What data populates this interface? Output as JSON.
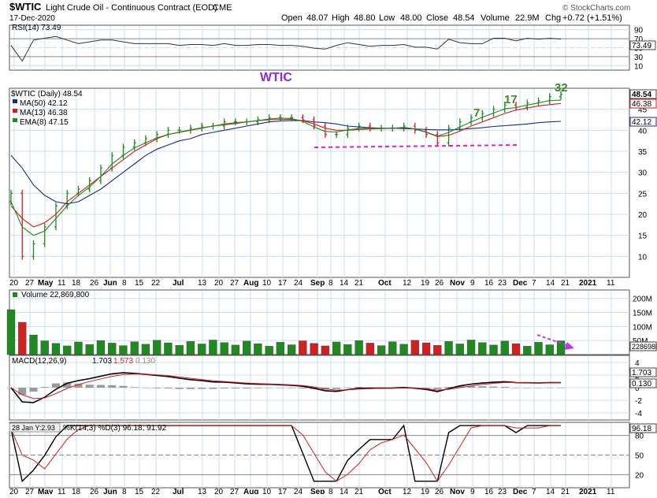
{
  "header": {
    "symbol": "$WTIC",
    "name": "Light Crude Oil - Continuous Contract (EOD)",
    "exchange": "CME",
    "date": "17-Dec-2020",
    "open_label": "Open",
    "open": "48.07",
    "high_label": "High",
    "high": "48.80",
    "low_label": "Low",
    "low": "48.00",
    "close_label": "Close",
    "close": "48.54",
    "volume_label": "Volume",
    "volume": "22.9M",
    "chg_label": "Chg",
    "chg": "+0.72 (+1.51%)",
    "brand": "© StockCharts.com"
  },
  "rsi_panel": {
    "legend": "RSI(14) 73.49",
    "ticks": [
      "90",
      "70",
      "50",
      "30",
      "10"
    ],
    "value_label": "73.49"
  },
  "price_panel": {
    "title_annotation": "WTIC",
    "legend": {
      "main": "$WTIC (Daily) 48.54",
      "ma50": "MA(50) 42.12",
      "ma13": "MA(13) 46.38",
      "ema8": "EMA(8) 47.15"
    },
    "ticks": [
      "45",
      "40",
      "35",
      "30",
      "25",
      "20",
      "15",
      "10"
    ],
    "price_label": "48.54",
    "ma13_label": "46.38",
    "ma50_label": "42.12",
    "count_labels": [
      "7",
      "17",
      "32"
    ]
  },
  "x_axis": {
    "labels": [
      "20",
      "27",
      "May",
      "11",
      "18",
      "26",
      "Jun",
      "8",
      "15",
      "22",
      "Jul",
      "13",
      "20",
      "27",
      "Aug",
      "10",
      "17",
      "24",
      "Sep",
      "8",
      "14",
      "21",
      "Oct",
      "12",
      "19",
      "26",
      "Nov",
      "9",
      "16",
      "23",
      "Dec",
      "7",
      "14",
      "21",
      "2021",
      "11"
    ]
  },
  "volume_panel": {
    "legend": "Volume 22,869,800",
    "ticks": [
      "200M",
      "150M",
      "100M",
      "50M"
    ],
    "value_label": "22869800"
  },
  "macd_panel": {
    "legend_label": "MACD(12,26,9)",
    "macd": "1.703",
    "signal": "1.573",
    "hist": "0.130",
    "ticks": [
      "4",
      "2",
      "0",
      "-2",
      "-4"
    ],
    "macd_label": "1.703",
    "hist_label": "0.130"
  },
  "stoch_panel": {
    "tooltip": "28 Jan Y:2.93",
    "legend": "%K(14,3) %D(3) 96.18, 91.92",
    "ticks": [
      "80",
      "50",
      "20"
    ],
    "value_label": "96.18"
  },
  "colors": {
    "bg": "#ffffff",
    "grid": "#c9dff0",
    "up": "#1f8a1f",
    "down": "#d02020",
    "ma50": "#1a2a8a",
    "ma13": "#d02020",
    "ema8": "#1f8a1f",
    "annotation_purple": "#8a2be2",
    "annotation_magenta": "#e020c8",
    "count_green": "#3a8a2a",
    "hist": "#9a9a9a"
  },
  "chart_data": {
    "type": "line",
    "title": "$WTIC Light Crude Oil - Continuous Contract (EOD)",
    "series": [
      {
        "name": "$WTIC (Daily)",
        "values": [
          25,
          10,
          13,
          17,
          22,
          25,
          26,
          28,
          31,
          34,
          36,
          37,
          38,
          39,
          40,
          40,
          40.5,
          41,
          41,
          42,
          42,
          42,
          42.5,
          43,
          43,
          43,
          42.5,
          41,
          39,
          39,
          40.5,
          41,
          40.5,
          40.5,
          40.5,
          41,
          40,
          39,
          37,
          40.5,
          42,
          43,
          44,
          45,
          46,
          45.5,
          46.5,
          47,
          48,
          48.54
        ]
      },
      {
        "name": "MA(50)",
        "values": [
          34,
          31,
          27,
          24.5,
          23,
          22.5,
          23,
          24.5,
          26,
          28,
          30,
          32,
          34,
          35.5,
          36.5,
          37.5,
          38,
          39,
          39.5,
          40,
          40.5,
          41,
          41.5,
          42,
          42.2,
          42.3,
          42.3,
          42,
          41.8,
          41.5,
          41,
          40.8,
          40.6,
          40.5,
          40.5,
          40.4,
          40.3,
          40.2,
          40.1,
          40.1,
          40.2,
          40.4,
          40.6,
          40.9,
          41.1,
          41.3,
          41.5,
          41.8,
          42,
          42.12
        ]
      },
      {
        "name": "MA(13)",
        "values": [
          22,
          19,
          17,
          18,
          20,
          23,
          25,
          27,
          29,
          31,
          33,
          35,
          36.5,
          38,
          39,
          39.5,
          40,
          40.5,
          41,
          41.3,
          41.6,
          42,
          42.3,
          42.5,
          42.6,
          42.6,
          42.3,
          41.5,
          40.5,
          40,
          40,
          40.2,
          40.3,
          40.4,
          40.5,
          40.6,
          40.3,
          39.5,
          38.5,
          38.8,
          39.8,
          41,
          42,
          43,
          44,
          44.8,
          45.3,
          45.8,
          46.1,
          46.38
        ]
      },
      {
        "name": "EMA(8)",
        "values": [
          23,
          17,
          15,
          16,
          19,
          22,
          24.5,
          26.5,
          29,
          32,
          34,
          35.8,
          37,
          38.2,
          39,
          39.6,
          40.1,
          40.6,
          41,
          41.5,
          41.8,
          42,
          42.3,
          42.7,
          42.9,
          42.8,
          42.1,
          40.8,
          39.7,
          39.6,
          40.1,
          40.4,
          40.5,
          40.5,
          40.5,
          40.7,
          40.3,
          39.6,
          38.6,
          39.5,
          40.8,
          42,
          43.1,
          44.1,
          45.1,
          45.4,
          46,
          46.5,
          47.1,
          47.15
        ]
      }
    ],
    "ylim": [
      5,
      50
    ],
    "x_tick_labels": [
      "20",
      "27",
      "May",
      "11",
      "18",
      "26",
      "Jun",
      "8",
      "15",
      "22",
      "Jul",
      "13",
      "20",
      "27",
      "Aug",
      "10",
      "17",
      "24",
      "Sep",
      "8",
      "14",
      "21",
      "Oct",
      "12",
      "19",
      "26",
      "Nov",
      "9",
      "16",
      "23",
      "Dec",
      "7",
      "14",
      "21",
      "2021",
      "11"
    ],
    "indicators": {
      "rsi14": {
        "last": 73.49,
        "ylim": [
          0,
          100
        ]
      },
      "volume": {
        "last": 22869800
      },
      "macd": {
        "macd": 1.703,
        "signal": 1.573,
        "histogram": 0.13
      },
      "stochastic": {
        "k": 96.18,
        "d": 91.92
      }
    }
  }
}
